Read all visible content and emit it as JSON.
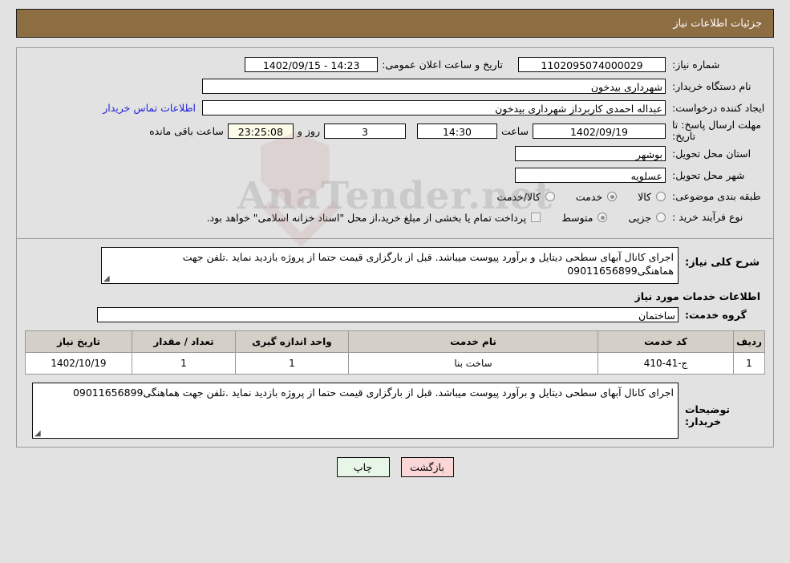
{
  "header": {
    "title": "جزئیات اطلاعات نیاز"
  },
  "watermark": {
    "text": "AnaTender.net",
    "shield_icon": "shield-icon",
    "check_icon": "check-icon"
  },
  "form": {
    "need_number": {
      "label": "شماره نیاز:",
      "value": "1102095074000029"
    },
    "public_announce": {
      "label": "تاریخ و ساعت اعلان عمومی:",
      "value": "14:23 - 1402/09/15"
    },
    "buyer_org": {
      "label": "نام دستگاه خریدار:",
      "value": "شهرداری بیدخون"
    },
    "request_creator": {
      "label": "ایجاد کننده درخواست:",
      "value": "عبداله احمدی کاربرداز شهرداری بیدخون"
    },
    "contact_link": {
      "label": "اطلاعات تماس خریدار"
    },
    "response_deadline": {
      "label": "مهلت ارسال پاسخ: تا تاریخ:",
      "date": "1402/09/19",
      "time_label": "ساعت",
      "time": "14:30",
      "days": "3",
      "days_label": "روز و",
      "countdown": "23:25:08",
      "countdown_label": "ساعت باقی مانده"
    },
    "delivery_province": {
      "label": "استان محل تحویل:",
      "value": "بوشهر"
    },
    "delivery_city": {
      "label": "شهر محل تحویل:",
      "value": "عسلویه"
    },
    "subject_category": {
      "label": "طبقه بندی موضوعی:",
      "options": [
        {
          "label": "کالا",
          "selected": false
        },
        {
          "label": "خدمت",
          "selected": true
        },
        {
          "label": "کالا/خدمت",
          "selected": false
        }
      ]
    },
    "purchase_type": {
      "label": "نوع فرآیند خرید :",
      "options": [
        {
          "label": "جزیی",
          "selected": false
        },
        {
          "label": "متوسط",
          "selected": true
        }
      ],
      "payment_checkbox_checked": false,
      "payment_note": "پرداخت تمام یا بخشی از مبلغ خرید،از محل \"اسناد خزانه اسلامی\" خواهد بود."
    }
  },
  "description": {
    "label": "شرح کلی نیاز:",
    "value": "اجرای کانال آبهای سطحی دیتایل و برآورد پیوست میباشد. قبل از بارگزاری قیمت حتما از پروژه بازدید نماید .تلفن جهت هماهنگی09011656899"
  },
  "services": {
    "heading": "اطلاعات خدمات مورد نیاز",
    "group_label": "گروه خدمت:",
    "group_value": "ساختمان",
    "table": {
      "columns": [
        "ردیف",
        "کد خدمت",
        "نام خدمت",
        "واحد اندازه گیری",
        "تعداد / مقدار",
        "تاریخ نیاز"
      ],
      "rows": [
        {
          "radif": "1",
          "code": "ج-41-410",
          "name": "ساخت بنا",
          "unit": "1",
          "qty": "1",
          "date": "1402/10/19"
        }
      ]
    }
  },
  "buyer_notes": {
    "label": "توضیحات خریدار:",
    "value": "اجرای کانال آبهای سطحی دیتایل و برآورد پیوست میباشد. قبل از بارگزاری قیمت حتما از پروژه بازدید نماید .تلفن جهت هماهنگی09011656899"
  },
  "footer": {
    "print_label": "چاپ",
    "back_label": "بازگشت"
  },
  "colors": {
    "header_bg": "#8d6d42",
    "page_bg": "#e2e2e2",
    "link": "#2222dd",
    "print_btn": "#e8f6e8",
    "back_btn": "#fbd6d6",
    "countdown_bg": "#fbfbe8",
    "table_header_bg": "#d4d0c8"
  }
}
